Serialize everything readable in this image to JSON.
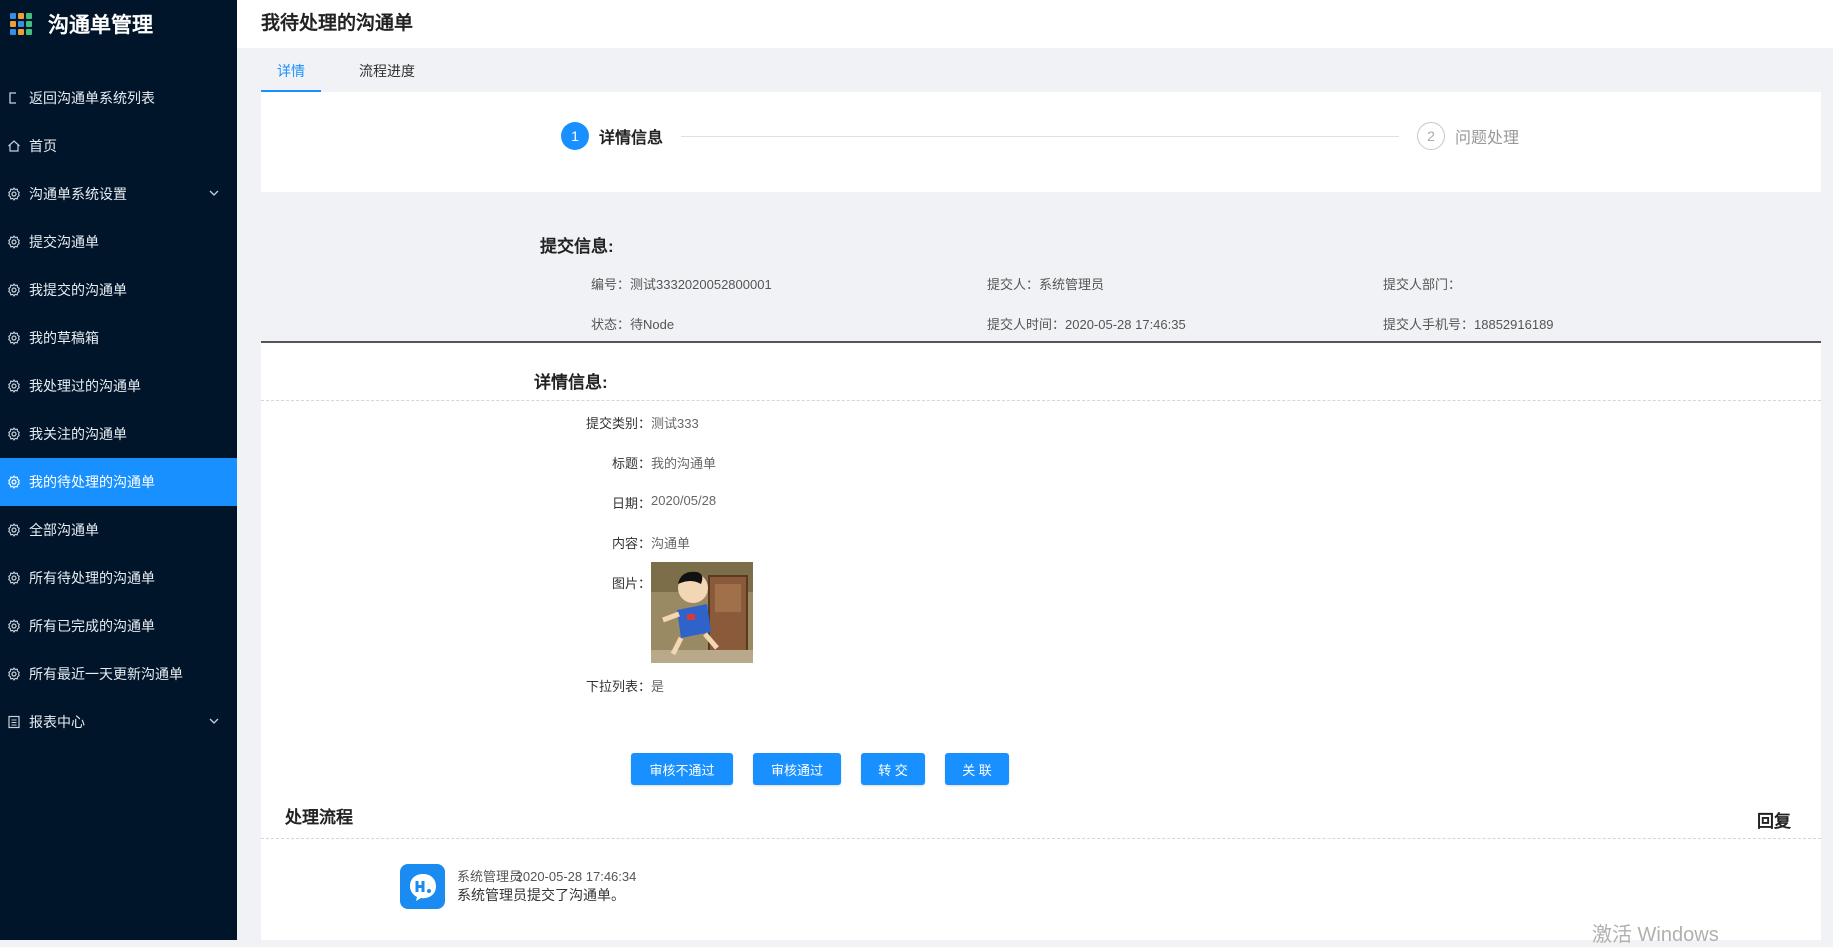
{
  "brand": {
    "title": "沟通单管理"
  },
  "sidebar": {
    "items": [
      {
        "label": "返回沟通单系统列表",
        "icon": "return-icon"
      },
      {
        "label": "首页",
        "icon": "home-icon"
      },
      {
        "label": "沟通单系统设置",
        "icon": "gear-icon",
        "expandable": true
      },
      {
        "label": "提交沟通单",
        "icon": "gear-icon"
      },
      {
        "label": "我提交的沟通单",
        "icon": "gear-icon"
      },
      {
        "label": "我的草稿箱",
        "icon": "gear-icon"
      },
      {
        "label": "我处理过的沟通单",
        "icon": "gear-icon"
      },
      {
        "label": "我关注的沟通单",
        "icon": "gear-icon"
      },
      {
        "label": "我的待处理的沟通单",
        "icon": "gear-icon",
        "active": true
      },
      {
        "label": "全部沟通单",
        "icon": "gear-icon"
      },
      {
        "label": "所有待处理的沟通单",
        "icon": "gear-icon"
      },
      {
        "label": "所有已完成的沟通单",
        "icon": "gear-icon"
      },
      {
        "label": "所有最近一天更新沟通单",
        "icon": "gear-icon"
      },
      {
        "label": "报表中心",
        "icon": "report-icon",
        "expandable": true
      }
    ]
  },
  "header": {
    "title": "我待处理的沟通单"
  },
  "tabs": [
    {
      "label": "详情",
      "active": true
    },
    {
      "label": "流程进度"
    }
  ],
  "steps": [
    {
      "number": "1",
      "label": "详情信息",
      "active": true
    },
    {
      "number": "2",
      "label": "问题处理"
    }
  ],
  "submit_info": {
    "title": "提交信息:",
    "id": "编号：测试3332020052800001",
    "submitter": "提交人：系统管理员",
    "department": "提交人部门：",
    "status": "状态：待Node",
    "time": "提交人时间：2020-05-28 17:46:35",
    "phone": "提交人手机号：18852916189"
  },
  "detail": {
    "title": "详情信息:",
    "fields": [
      {
        "label": "提交类别：",
        "value": "测试333"
      },
      {
        "label": "标题：",
        "value": "我的沟通单"
      },
      {
        "label": "日期：",
        "value": "2020/05/28"
      },
      {
        "label": "内容：",
        "value": "沟通单"
      },
      {
        "label": "图片：",
        "value": ""
      },
      {
        "label": "下拉列表：",
        "value": "是"
      }
    ]
  },
  "actions": {
    "reject": "审核不通过",
    "approve": "审核通过",
    "transfer": "转 交",
    "link": "关 联"
  },
  "flow": {
    "title": "处理流程",
    "reply": "回复",
    "entry": {
      "user": "系统管理员",
      "time": "2020-05-28 17:46:34",
      "text": "系统管理员提交了沟通单。"
    }
  },
  "watermark": "激活 Windows",
  "colors": {
    "sidebar": "#001529",
    "accent": "#1890ff",
    "background": "#f0f2f5"
  }
}
